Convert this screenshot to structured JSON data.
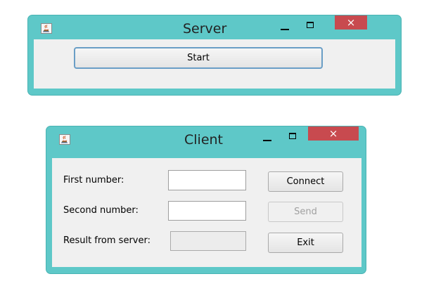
{
  "server_window": {
    "title": "Server",
    "close_glyph": "×",
    "icon": "java-cup-icon",
    "start_label": "Start"
  },
  "client_window": {
    "title": "Client",
    "close_glyph": "×",
    "icon": "java-cup-icon",
    "first_number_label": "First number:",
    "first_number_value": "",
    "second_number_label": "Second number:",
    "second_number_value": "",
    "result_label": "Result from server:",
    "result_value": "",
    "connect_label": "Connect",
    "send_label": "Send",
    "exit_label": "Exit"
  }
}
